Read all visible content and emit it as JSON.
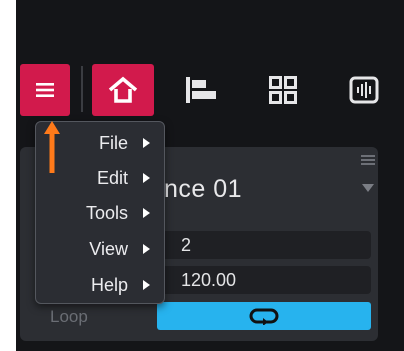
{
  "toolbar": {
    "menu_icon": "hamburger-icon",
    "home_icon": "home-icon",
    "align_icon": "align-left-icon",
    "grid_icon": "grid-icon",
    "wave_icon": "waveform-icon",
    "accent": "#d21a4c"
  },
  "panel": {
    "title": "nce 01",
    "bars_value": "2",
    "bpm_value": "120.00",
    "loop_label": "Loop",
    "loop_icon": "loop-icon",
    "loop_color": "#27b3ee"
  },
  "menu": {
    "items": [
      {
        "label": "File"
      },
      {
        "label": "Edit"
      },
      {
        "label": "Tools"
      },
      {
        "label": "View"
      },
      {
        "label": "Help"
      }
    ]
  },
  "annotation": {
    "arrow_color": "#ff7a1a"
  }
}
